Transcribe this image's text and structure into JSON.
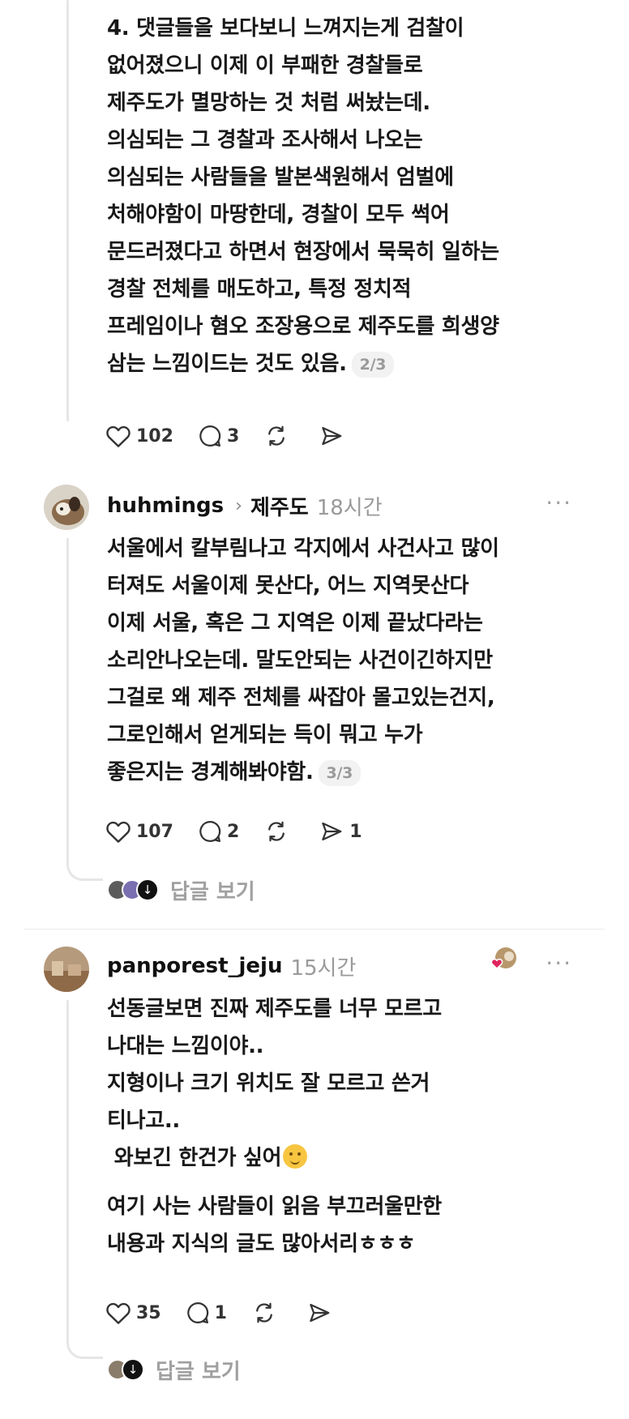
{
  "post_top": {
    "lines": [
      "4. 댓글들을 보다보니 느껴지는게 검찰이",
      "없어졌으니 이제 이 부패한 경찰들로",
      "제주도가 멸망하는 것 처럼 써놨는데.",
      "의심되는 그 경찰과 조사해서 나오는",
      "의심되는 사람들을 발본색원해서 엄벌에",
      "처해야함이 마땅한데, 경찰이 모두 썩어",
      "문드러졌다고 하면서 현장에서 묵묵히 일하는",
      "경찰 전체를 매도하고, 특정 정치적",
      "프레임이나 혐오 조장용으로 제주도를 희생양",
      "삼는 느낌이드는 것도 있음."
    ],
    "page": "2/3",
    "likes": "102",
    "comments": "3",
    "reposts": "",
    "shares": ""
  },
  "comment1": {
    "username": "huhmings",
    "community": "제주도",
    "time": "18시간",
    "more": "···",
    "lines": [
      "서울에서 칼부림나고 각지에서 사건사고 많이",
      "터져도 서울이제 못산다, 어느 지역못산다",
      "이제 서울, 혹은 그 지역은 이제 끝났다라는",
      "소리안나오는데. 말도안되는 사건이긴하지만",
      "그걸로 왜 제주 전체를 싸잡아 몰고있는건지,",
      "그로인해서 얻게되는 득이 뭐고 누가",
      "좋은지는 경계해봐야함."
    ],
    "page": "3/3",
    "likes": "107",
    "comments": "2",
    "reposts": "",
    "shares": "1",
    "view_replies": "답글 보기"
  },
  "comment2": {
    "username": "panporest_jeju",
    "time": "15시간",
    "more": "···",
    "paragraph1": [
      "선동글보면 진짜 제주도를 너무 모르고",
      "나대는 느낌이야..",
      "지형이나 크기 위치도 잘 모르고 쓴거",
      "티나고..",
      " 와보긴 한건가 싶어"
    ],
    "paragraph2": [
      "여기 사는 사람들이 읽음 부끄러울만한",
      "내용과 지식의 글도 많아서리ㅎㅎㅎ"
    ],
    "likes": "35",
    "comments": "1",
    "reposts": "",
    "shares": "",
    "view_replies": "답글 보기"
  },
  "colors": {
    "text": "#181818",
    "muted": "#9a9a9a",
    "thread_line": "#e6e6e6",
    "liked_heart": "#e0245e"
  }
}
